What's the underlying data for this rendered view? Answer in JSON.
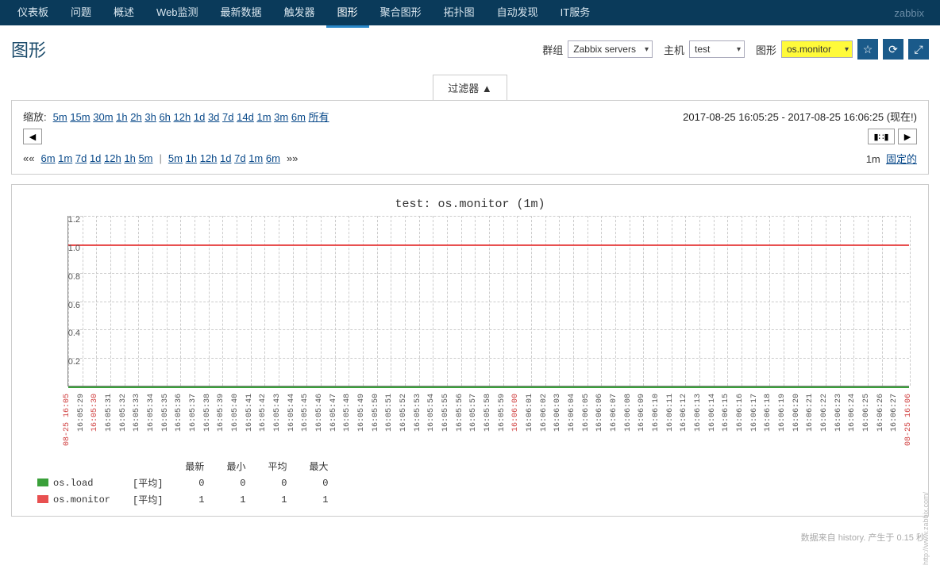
{
  "nav": {
    "items": [
      "仪表板",
      "问题",
      "概述",
      "Web监测",
      "最新数据",
      "触发器",
      "图形",
      "聚合图形",
      "拓扑图",
      "自动发现",
      "IT服务"
    ],
    "active": 6,
    "brand": "zabbix"
  },
  "header": {
    "title": "图形",
    "filters": {
      "group_lbl": "群组",
      "group_val": "Zabbix servers",
      "host_lbl": "主机",
      "host_val": "test",
      "graph_lbl": "图形",
      "graph_val": "os.monitor"
    },
    "icons": {
      "fav": "☆",
      "refresh": "⟳",
      "full": "⤢"
    }
  },
  "filterTab": "过滤器 ▲",
  "zoom": {
    "label": "缩放:",
    "opts": [
      "5m",
      "15m",
      "30m",
      "1h",
      "2h",
      "3h",
      "6h",
      "12h",
      "1d",
      "3d",
      "7d",
      "14d",
      "1m",
      "3m",
      "6m",
      "所有"
    ],
    "range": "2017-08-25 16:05:25 - 2017-08-25 16:06:25 (现在!)",
    "arrows": {
      "prev": "◀",
      "bar": "▮∷▮",
      "next": "▶"
    },
    "shift": {
      "pre": "«« ",
      "left": [
        "6m",
        "1m",
        "7d",
        "1d",
        "12h",
        "1h",
        "5m"
      ],
      "right": [
        "5m",
        "1h",
        "12h",
        "1d",
        "7d",
        "1m",
        "6m"
      ],
      "post": " »»",
      "fixed_dur": "1m",
      "fixed_lbl": "固定的"
    }
  },
  "chart_data": {
    "type": "line",
    "title": "test: os.monitor (1m)",
    "ylabel": "",
    "xlabel": "",
    "ylim": [
      0,
      1.2
    ],
    "yticks": [
      0.2,
      0.4,
      0.6,
      0.8,
      1.0,
      1.2
    ],
    "x": [
      "08-25 16:05",
      "16:05:29",
      "16:05:30",
      "16:05:31",
      "16:05:32",
      "16:05:33",
      "16:05:34",
      "16:05:35",
      "16:05:36",
      "16:05:37",
      "16:05:38",
      "16:05:39",
      "16:05:40",
      "16:05:41",
      "16:05:42",
      "16:05:43",
      "16:05:44",
      "16:05:45",
      "16:05:46",
      "16:05:47",
      "16:05:48",
      "16:05:49",
      "16:05:50",
      "16:05:51",
      "16:05:52",
      "16:05:53",
      "16:05:54",
      "16:05:55",
      "16:05:56",
      "16:05:57",
      "16:05:58",
      "16:05:59",
      "16:06:00",
      "16:06:01",
      "16:06:02",
      "16:06:03",
      "16:06:04",
      "16:06:05",
      "16:06:06",
      "16:06:07",
      "16:06:08",
      "16:06:09",
      "16:06:10",
      "16:06:11",
      "16:06:12",
      "16:06:13",
      "16:06:14",
      "16:06:15",
      "16:06:16",
      "16:06:17",
      "16:06:18",
      "16:06:19",
      "16:06:20",
      "16:06:21",
      "16:06:22",
      "16:06:23",
      "16:06:24",
      "16:06:25",
      "16:06:26",
      "16:06:27",
      "08-25 16:06"
    ],
    "x_red": [
      0,
      2,
      32,
      60
    ],
    "series": [
      {
        "name": "os.load",
        "color": "#3aa03a",
        "agg": "[平均]",
        "last": 0,
        "min": 0,
        "avg": 0,
        "max": 0,
        "const": 0
      },
      {
        "name": "os.monitor",
        "color": "#e85050",
        "agg": "[平均]",
        "last": 1,
        "min": 1,
        "avg": 1,
        "max": 1,
        "const": 1
      }
    ],
    "legend_cols": [
      "最新",
      "最小",
      "平均",
      "最大"
    ],
    "watermark": "http://www.zabbix.com/"
  },
  "footer": "数据来自 history. 产生于 0.15 秒."
}
